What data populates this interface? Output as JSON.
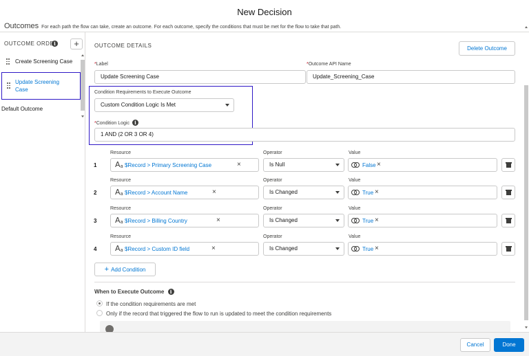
{
  "modal": {
    "title": "New Decision"
  },
  "section": {
    "heading": "Outcomes",
    "description": "For each path the flow can take, create an outcome. For each outcome, specify the conditions that must be met for the flow to take that path."
  },
  "outcome_order": {
    "label": "OUTCOME ORDER",
    "add_symbol": "+",
    "items": [
      {
        "label": "Create Screening Case"
      },
      {
        "label": "Update Screening Case",
        "selected": true
      }
    ],
    "default_item": "Default Outcome"
  },
  "details": {
    "title": "OUTCOME DETAILS",
    "delete_button": "Delete Outcome",
    "label_field": {
      "label": "Label",
      "value": "Update Screening Case"
    },
    "api_name_field": {
      "label": "Outcome API Name",
      "value": "Update_Screening_Case"
    },
    "condition_requirements": {
      "label": "Condition Requirements to Execute Outcome",
      "value": "Custom Condition Logic Is Met"
    },
    "condition_logic": {
      "label": "Condition Logic",
      "value": "1 AND (2 OR 3 OR 4)"
    }
  },
  "conditions": {
    "headers": {
      "resource": "Resource",
      "operator": "Operator",
      "value": "Value"
    },
    "resource_type_icon": "text-type-icon",
    "rows": [
      {
        "num": "1",
        "resource": "$Record > Primary Screening Case",
        "operator": "Is Null",
        "value": "False"
      },
      {
        "num": "2",
        "resource": "$Record > Account Name",
        "operator": "Is Changed",
        "value": "True"
      },
      {
        "num": "3",
        "resource": "$Record > Billing Country",
        "operator": "Is Changed",
        "value": "True"
      },
      {
        "num": "4",
        "resource": "$Record > Custom ID field",
        "operator": "Is Changed",
        "value": "True"
      }
    ],
    "remove_symbol": "×",
    "add_button": "Add Condition",
    "add_symbol": "+"
  },
  "when_to_execute": {
    "title": "When to Execute Outcome",
    "options": [
      {
        "label": "If the condition requirements are met",
        "selected": true
      },
      {
        "label": "Only if the record that triggered the flow to run is updated to meet the condition requirements",
        "selected": false
      }
    ]
  },
  "info_symbol": "i",
  "footer": {
    "cancel": "Cancel",
    "done": "Done"
  },
  "colors": {
    "brand": "#0176d3",
    "highlight": "#2e18c6",
    "required": "#ba0517"
  }
}
